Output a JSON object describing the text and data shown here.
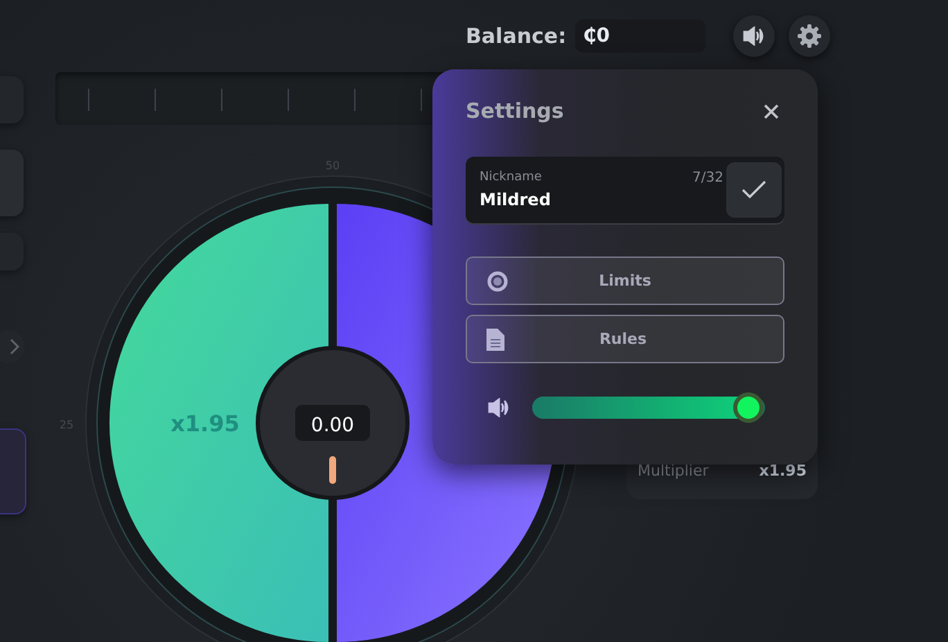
{
  "header": {
    "balance_label": "Balance:",
    "balance_value": "₵0"
  },
  "wheel": {
    "scale_labels": [
      "50",
      "25"
    ],
    "segments": [
      {
        "label": "x1.95",
        "color": "#44d99b"
      },
      {
        "color": "#5b3ff5"
      }
    ],
    "reading": "0.00"
  },
  "multiplier_card": {
    "label": "Multiplier",
    "value": "x1.95"
  },
  "settings": {
    "title": "Settings",
    "nickname": {
      "label": "Nickname",
      "value": "Mildred",
      "counter": "7/32"
    },
    "buttons": [
      {
        "kind": "limits",
        "label": "Limits"
      },
      {
        "kind": "rules",
        "label": "Rules"
      }
    ],
    "volume": {
      "level": 0.93
    }
  }
}
